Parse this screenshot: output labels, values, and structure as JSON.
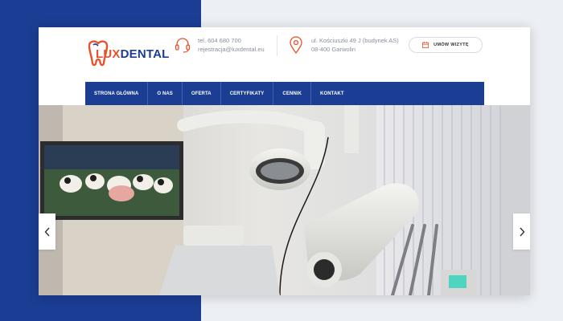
{
  "brand": {
    "logo_part1": "LUX",
    "logo_part2": "DENTAL"
  },
  "header": {
    "phone": "tel. 604 680 700",
    "email": "rejestracja@luxdental.eu",
    "address_line1": "ul. Kościuszki 49 J (budynek AS)",
    "address_line2": "08-400 Garwolin",
    "cta_label": "UMÓW WIZYTĘ"
  },
  "nav": {
    "items": [
      {
        "label": "STRONA GŁÓWNA"
      },
      {
        "label": "O NAS"
      },
      {
        "label": "OFERTA"
      },
      {
        "label": "CERTYFIKATY"
      },
      {
        "label": "CENNIK"
      },
      {
        "label": "KONTAKT"
      }
    ]
  },
  "slider": {
    "prev_icon": "chevron-left-icon",
    "next_icon": "chevron-right-icon"
  },
  "colors": {
    "brand_blue": "#1b3d93",
    "accent_orange": "#e8522b"
  }
}
